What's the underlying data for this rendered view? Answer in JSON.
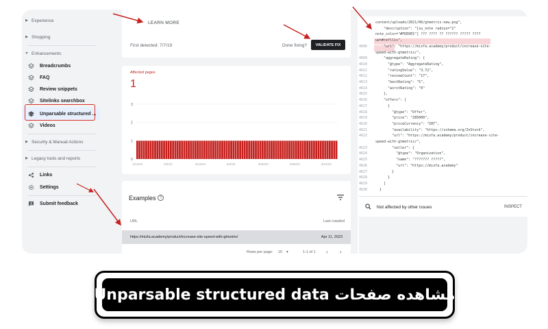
{
  "sidebar": {
    "items": [
      {
        "label": "Experience",
        "type": "section"
      },
      {
        "label": "Shopping",
        "type": "section"
      },
      {
        "label": "Enhancements",
        "type": "section-open"
      },
      {
        "label": "Breadcrumbs",
        "type": "sub"
      },
      {
        "label": "FAQ",
        "type": "sub"
      },
      {
        "label": "Review snippets",
        "type": "sub"
      },
      {
        "label": "Sitelinks searchbox",
        "type": "sub"
      },
      {
        "label": "Unparsable structured ...",
        "type": "sub-active"
      },
      {
        "label": "Videos",
        "type": "sub"
      },
      {
        "label": "Security & Manual Actions",
        "type": "section"
      },
      {
        "label": "Legacy tools and reports",
        "type": "section"
      },
      {
        "label": "Links",
        "type": "link"
      },
      {
        "label": "Settings",
        "type": "link"
      },
      {
        "label": "Submit feedback",
        "type": "link"
      }
    ]
  },
  "issue": {
    "learn_more": "LEARN MORE",
    "first_detected": "First detected: 7/7/19",
    "done_fixing": "Done fixing?",
    "validate_button": "VALIDATE FIX"
  },
  "chart_data": {
    "type": "bar",
    "title": "Affected pages",
    "big_value": "1",
    "yticks": [
      "3",
      "2",
      "1",
      "0"
    ],
    "ylim": [
      0,
      3
    ],
    "xticks": [
      "1/14/23",
      "2/2/23",
      "2/14/23",
      "3/2/23",
      "3/20/23",
      "3/30/23",
      "4/12/23"
    ],
    "bar_count": 90,
    "values_all": 1,
    "bar_color": "#c5221f"
  },
  "examples": {
    "title": "Examples",
    "help": "?",
    "col_url": "URL",
    "col_last_crawled": "Last crawled",
    "rows": [
      {
        "url": "https://mizfa.academy/product/increase-site-speed-with-gtmetrix/",
        "date": "Apr 11, 2023"
      }
    ],
    "rows_per_page_label": "Rows per page:",
    "rows_per_page_value": "10",
    "range": "1-1 of 1"
  },
  "code": {
    "lines": [
      {
        "n": "",
        "text": "content/uploads/2021/06/gtmetrix-new.png\","
      },
      {
        "n": "",
        "text": "    \"description\": \"[su_note radius=\"2\""
      },
      {
        "n": "",
        "text": "note_color=\"#FDE0E5\"] ??? ???? ?? ?????? ????? ????"
      },
      {
        "n": "",
        "text": "ue=#refllis\","
      },
      {
        "n": "4606",
        "text": "    \"url\": \"https://mizfa.academy/product/increase-site-"
      },
      {
        "n": "",
        "text": "speed-with-gtmetrix/\","
      },
      {
        "n": "4609",
        "text": "    \"aggregateRating\": {"
      },
      {
        "n": "4610",
        "text": "      \"@type\": \"AggregateRating\","
      },
      {
        "n": "4611",
        "text": "      \"ratingValue\": \"3.72\","
      },
      {
        "n": "4612",
        "text": "      \"reviewCount\": \"17\","
      },
      {
        "n": "4613",
        "text": "      \"bestRating\": \"5\","
      },
      {
        "n": "4614",
        "text": "      \"worstRating\": \"0\""
      },
      {
        "n": "4615",
        "text": "    },"
      },
      {
        "n": "4616",
        "text": "    \"offers\": ["
      },
      {
        "n": "4617",
        "text": "      {"
      },
      {
        "n": "4618",
        "text": "        \"@type\": \"Offer\","
      },
      {
        "n": "4619",
        "text": "        \"price\": \"285000\","
      },
      {
        "n": "4620",
        "text": "        \"priceCurrency\": \"IRT\","
      },
      {
        "n": "4621",
        "text": "        \"availability\": \"https://schema.org/InStock\","
      },
      {
        "n": "4622",
        "text": "        \"url\": \"https://mizfa.academy/product/increase-site-"
      },
      {
        "n": "",
        "text": "speed-with-gtmetrix/\","
      },
      {
        "n": "4623",
        "text": "        \"seller\": {"
      },
      {
        "n": "4624",
        "text": "          \"@type\": \"Organization\","
      },
      {
        "n": "4625",
        "text": "          \"name\": \"??????? ?????\","
      },
      {
        "n": "4626",
        "text": "          \"url\": \"https://mizfa.academy\""
      },
      {
        "n": "4627",
        "text": "        }"
      },
      {
        "n": "4628",
        "text": "      }"
      },
      {
        "n": "4629",
        "text": "    ]"
      },
      {
        "n": "4630",
        "text": "  }"
      }
    ],
    "not_affected": "Not affected by other issues",
    "inspect": "INSPECT"
  },
  "caption": {
    "text": "مشاهده صفحات Unparsable structured data"
  },
  "colors": {
    "accent_red": "#c5221f",
    "arrow_red": "#c5221f",
    "panel_bg": "#f1f3f4"
  }
}
